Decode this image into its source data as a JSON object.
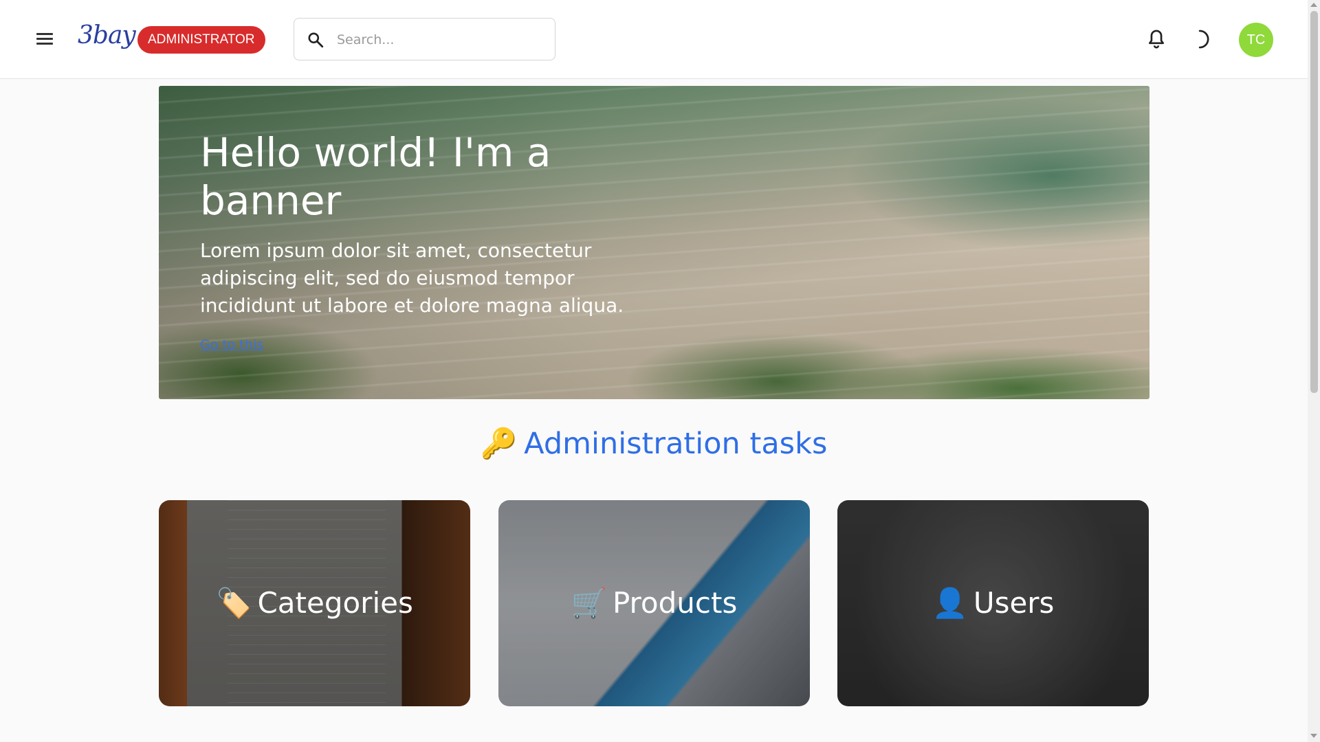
{
  "header": {
    "menu_icon": "menu-icon",
    "logo_text": "3bay",
    "role_badge": "ADMINISTRATOR",
    "search": {
      "placeholder": "Search...",
      "value": ""
    },
    "notification_icon": "bell-icon",
    "theme_icon": "moon-icon",
    "avatar_initials": "TC",
    "avatar_color": "#8fd93b",
    "badge_color": "#d82c2c"
  },
  "banner": {
    "title": "Hello world! I'm a banner",
    "text": "Lorem ipsum dolor sit amet, consectetur adipiscing elit, sed do eiusmod tempor incididunt ut labore et dolore magna aliqua.",
    "link": "Go to this"
  },
  "admin_section": {
    "title_emoji": "🔑",
    "title": "Administration tasks",
    "title_color": "#2f6ee6"
  },
  "tasks": [
    {
      "emoji": "🏷️",
      "label": "Categories"
    },
    {
      "emoji": "🛒",
      "label": "Products"
    },
    {
      "emoji": "👤",
      "label": "Users"
    }
  ]
}
